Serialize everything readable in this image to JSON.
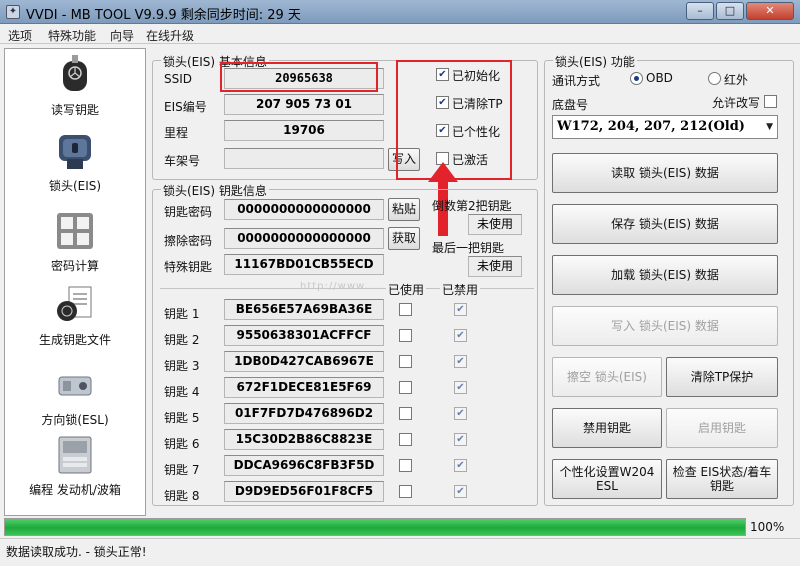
{
  "window": {
    "title": "VVDI - MB TOOL V9.9.9   剩余同步时间: 29 天",
    "minimize": "–",
    "maximize": "□",
    "close": "✕"
  },
  "menu": [
    "选项",
    "特殊功能",
    "向导",
    "在线升级"
  ],
  "sidebar": [
    {
      "label": "读写钥匙",
      "icon": "car-key-icon"
    },
    {
      "label": "锁头(EIS)",
      "icon": "ignition-lock-icon"
    },
    {
      "label": "密码计算",
      "icon": "password-calc-icon"
    },
    {
      "label": "生成钥匙文件",
      "icon": "key-file-icon"
    },
    {
      "label": "方向锁(ESL)",
      "icon": "steering-lock-icon"
    },
    {
      "label": "编程 发动机/波箱",
      "icon": "ecu-module-icon"
    }
  ],
  "basic_info": {
    "title": "锁头(EIS) 基本信息",
    "ssid_label": "SSID",
    "ssid": "20965638",
    "eis_no_label": "EIS编号",
    "eis_no": "207 905 73 01",
    "mileage_label": "里程",
    "mileage": "19706",
    "vin_label": "车架号",
    "vin": "",
    "write_button": "写入",
    "status": [
      {
        "label": "已初始化",
        "checked": true
      },
      {
        "label": "已清除TP",
        "checked": true
      },
      {
        "label": "已个性化",
        "checked": true
      },
      {
        "label": "已激活",
        "checked": false
      }
    ]
  },
  "key_info": {
    "title": "锁头(EIS) 钥匙信息",
    "key_password_label": "钥匙密码",
    "key_password": "0000000000000000",
    "paste_button": "粘贴",
    "erase_password_label": "擦除密码",
    "erase_password": "0000000000000000",
    "get_button": "获取",
    "special_key_label": "特殊钥匙",
    "special_key": "11167BD01CB55ECD",
    "second_last_key_label": "倒数第2把钥匙",
    "second_last_key": "未使用",
    "last_key_label": "最后一把钥匙",
    "last_key": "未使用",
    "used_header": "已使用",
    "disabled_header": "已禁用",
    "keys": [
      {
        "label": "钥匙 1",
        "value": "BE656E57A69BA36E",
        "used": false,
        "disabled": true
      },
      {
        "label": "钥匙 2",
        "value": "9550638301ACFFCF",
        "used": false,
        "disabled": true
      },
      {
        "label": "钥匙 3",
        "value": "1DB0D427CAB6967E",
        "used": false,
        "disabled": true
      },
      {
        "label": "钥匙 4",
        "value": "672F1DECE81E5F69",
        "used": false,
        "disabled": true
      },
      {
        "label": "钥匙 5",
        "value": "01F7FD7D476896D2",
        "used": false,
        "disabled": true
      },
      {
        "label": "钥匙 6",
        "value": "15C30D2B86C8823E",
        "used": false,
        "disabled": true
      },
      {
        "label": "钥匙 7",
        "value": "DDCA9696C8FB3F5D",
        "used": false,
        "disabled": true
      },
      {
        "label": "钥匙 8",
        "value": "D9D9ED56F01F8CF5",
        "used": false,
        "disabled": true
      }
    ]
  },
  "eis_functions": {
    "title": "锁头(EIS) 功能",
    "comm_label": "通讯方式",
    "obd_label": "OBD",
    "ir_label": "红外",
    "chassis_label": "底盘号",
    "allow_modify_label": "允许改写",
    "chassis_value": "W172, 204, 207, 212(Old)",
    "buttons": {
      "read": "读取 锁头(EIS) 数据",
      "save": "保存 锁头(EIS) 数据",
      "load": "加载 锁头(EIS) 数据",
      "write": "写入 锁头(EIS) 数据",
      "erase": "擦空 锁头(EIS)",
      "clear_tp": "清除TP保护",
      "disable_key": "禁用钥匙",
      "enable_key": "启用钥匙",
      "personalize": "个性化设置W204 ESL",
      "check_status": "检查 EIS状态/着车钥匙"
    }
  },
  "progress": {
    "percent_text": "100%",
    "fraction": 1.0
  },
  "status_text": "数据读取成功. - 锁头正常!",
  "colors": {
    "progress": "#1ea83a",
    "highlight": "#e2232b",
    "check": "#1a3b8a"
  }
}
